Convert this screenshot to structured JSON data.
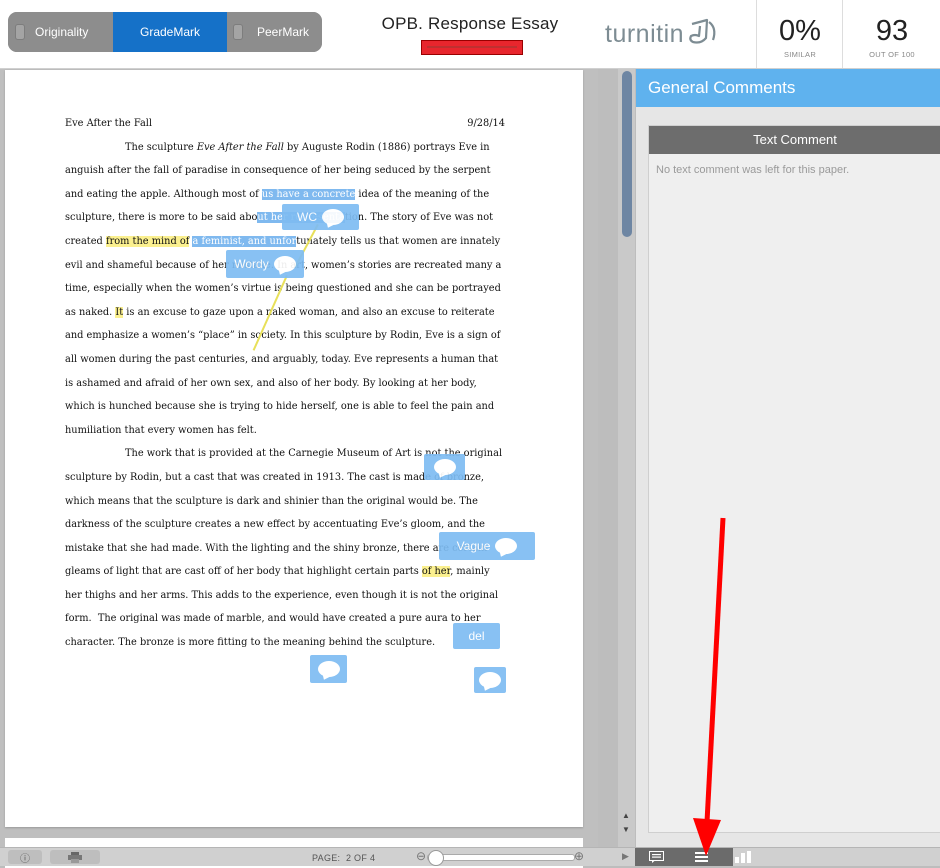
{
  "tabs": [
    {
      "label": "Originality",
      "active": false
    },
    {
      "label": "GradeMark",
      "active": true
    },
    {
      "label": "PeerMark",
      "active": false
    }
  ],
  "document": {
    "title": "OPB. Response Essay"
  },
  "brand": {
    "logo_text": "turnitin"
  },
  "similarity": {
    "value": "0%",
    "label": "SIMILAR"
  },
  "grade": {
    "value": "93",
    "label": "OUT OF 100"
  },
  "essay": {
    "heading": "Eve After the Fall",
    "date": "9/28/14"
  },
  "marks": {
    "wc": "WC",
    "wordy": "Wordy",
    "vague": "Vague",
    "del": "del"
  },
  "panel": {
    "header": "General Comments",
    "section_title": "Text Comment",
    "empty_text": "No text comment was left for this paper."
  },
  "bottom": {
    "page_label": "PAGE:",
    "page_value": "2 OF 4"
  },
  "colors": {
    "accent": "#1571c8",
    "panel_header": "#5fb2ee",
    "highlight": "#fbf08f",
    "mark": "#7ebcf2",
    "arrow": "#ff0000"
  }
}
